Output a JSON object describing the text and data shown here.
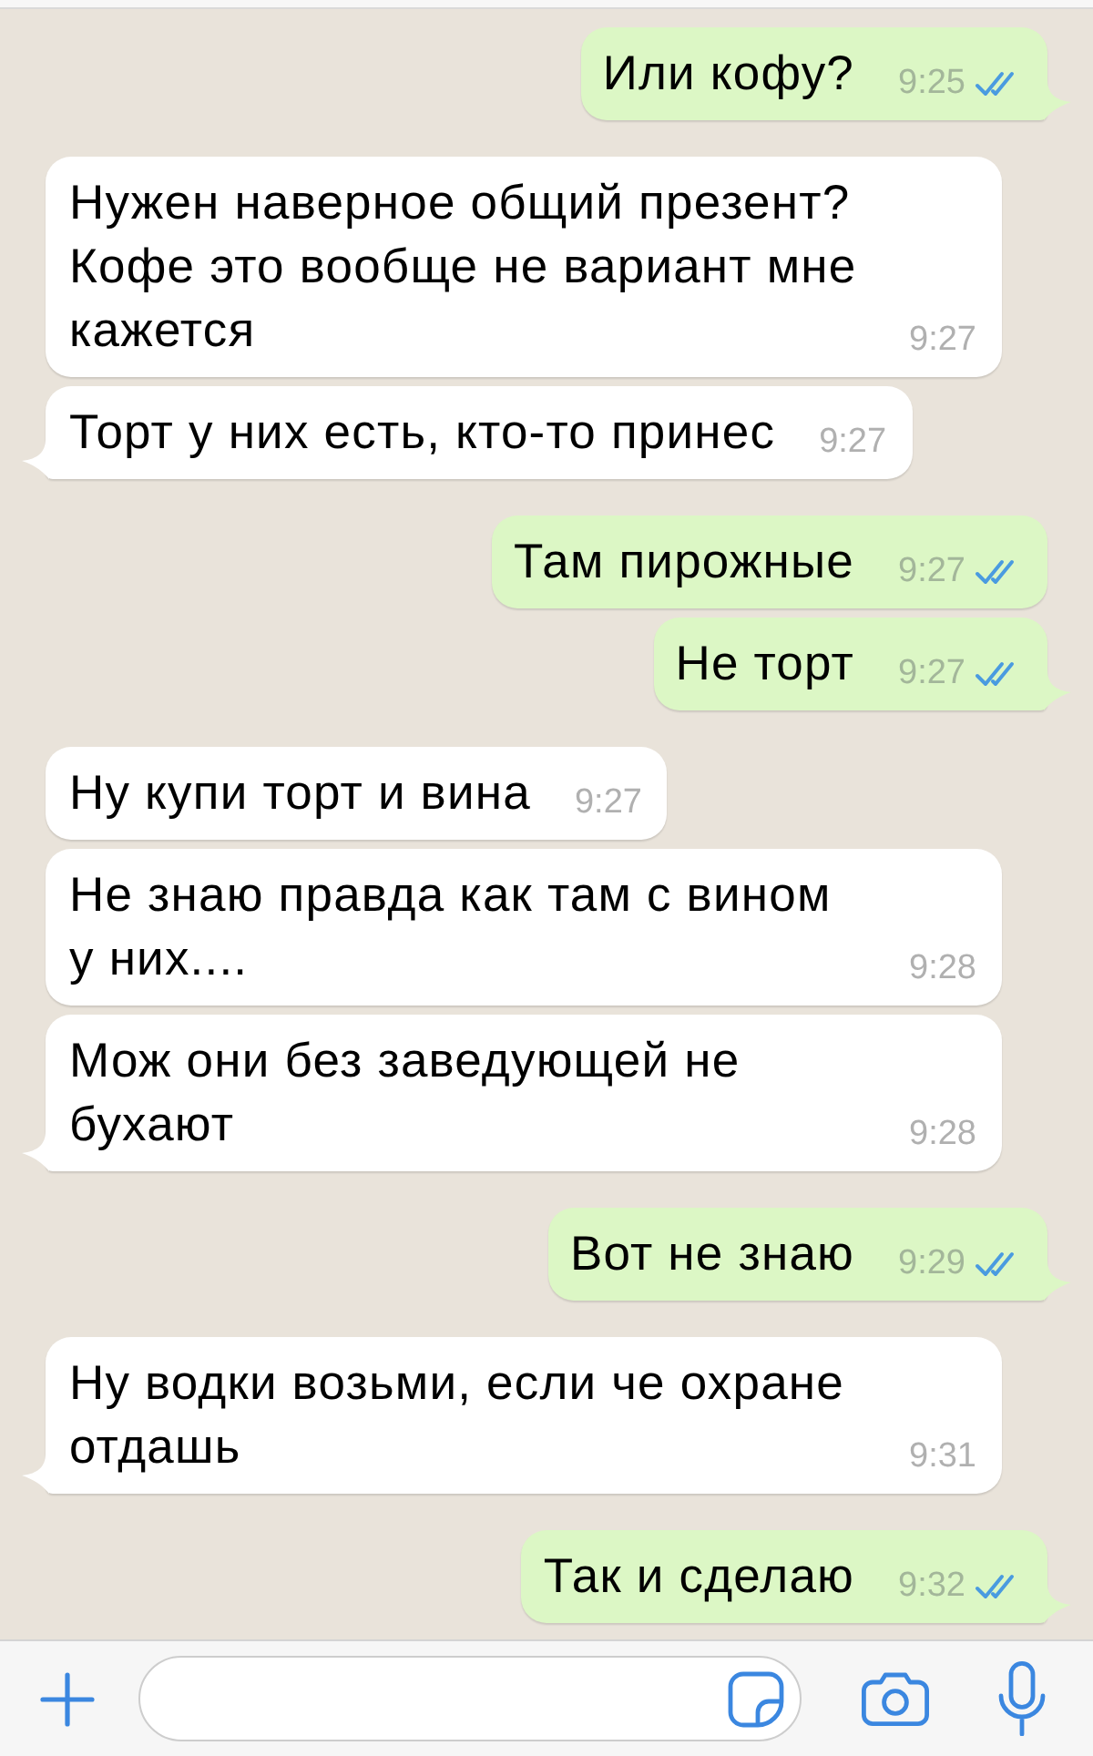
{
  "messages": [
    {
      "kind": "outgoing",
      "text": "Или кофу?",
      "time": "9:25",
      "tail": true,
      "read": true
    },
    {
      "kind": "incoming",
      "text": "Нужен наверное общий презент? Кофе это вообще не вариант мне кажется",
      "time": "9:27",
      "tail": false
    },
    {
      "kind": "incoming",
      "text": "Торт у них есть, кто-то принес",
      "time": "9:27",
      "tail": true
    },
    {
      "kind": "outgoing",
      "text": "Там пирожные",
      "time": "9:27",
      "tail": false,
      "read": true
    },
    {
      "kind": "outgoing",
      "text": "Не торт",
      "time": "9:27",
      "tail": true,
      "read": true
    },
    {
      "kind": "incoming",
      "text": "Ну купи торт и вина",
      "time": "9:27",
      "tail": false
    },
    {
      "kind": "incoming",
      "text": "Не знаю правда как там с вином у них....",
      "time": "9:28",
      "tail": false
    },
    {
      "kind": "incoming",
      "text": "Мож они без заведующей не бухают",
      "time": "9:28",
      "tail": true
    },
    {
      "kind": "outgoing",
      "text": "Вот не знаю",
      "time": "9:29",
      "tail": true,
      "read": true
    },
    {
      "kind": "incoming",
      "text": "Ну водки возьми, если че охране отдашь",
      "time": "9:31",
      "tail": true
    },
    {
      "kind": "outgoing",
      "text": "Так и сделаю",
      "time": "9:32",
      "tail": true,
      "read": true
    }
  ]
}
